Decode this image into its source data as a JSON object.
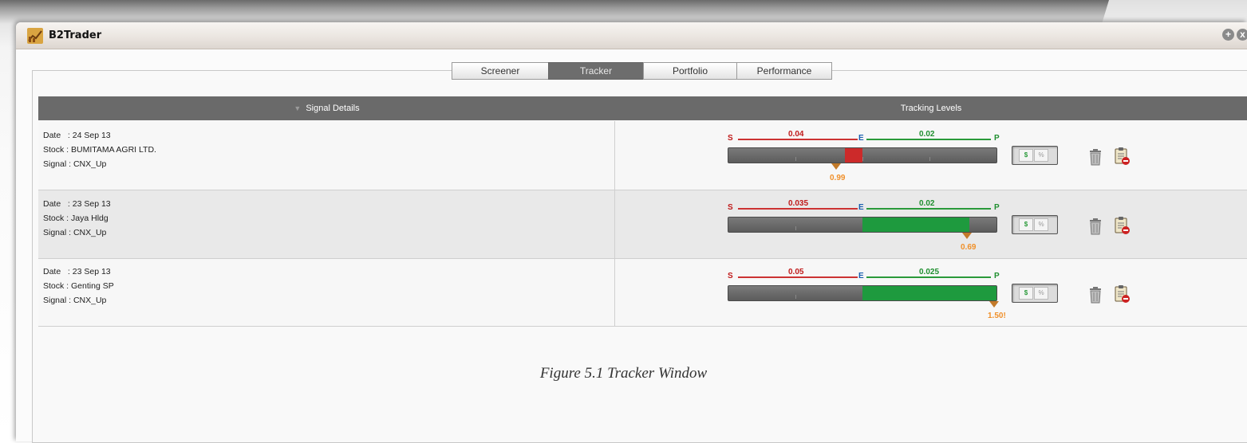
{
  "window": {
    "title": "B2Trader",
    "buttons": [
      "+",
      "x"
    ]
  },
  "tabs": [
    {
      "label": "Screener",
      "active": false
    },
    {
      "label": "Tracker",
      "active": true
    },
    {
      "label": "Portfolio",
      "active": false
    },
    {
      "label": "Performance",
      "active": false
    }
  ],
  "table": {
    "headers": {
      "signal": "Signal Details",
      "sort_indicator": "▼",
      "tracking": "Tracking Levels"
    },
    "level_labels": {
      "s": "S",
      "e": "E",
      "p": "P"
    },
    "toggle": {
      "dollar": "$",
      "percent": "%"
    },
    "rows": [
      {
        "date": "Date   : 24 Sep 13",
        "stock": "Stock : BUMITAMA AGRI LTD.",
        "signal": "Signal : CNX_Up",
        "stop_diff": "0.04",
        "profit_diff": "0.02",
        "current": "0.99",
        "fill_fraction": 0.1,
        "fill_color": "red"
      },
      {
        "date": "Date   : 23 Sep 13",
        "stock": "Stock : Jaya Hldg",
        "signal": "Signal : CNX_Up",
        "stop_diff": "0.035",
        "profit_diff": "0.02",
        "current": "0.69",
        "fill_fraction": 0.8,
        "fill_color": "green"
      },
      {
        "date": "Date   : 23 Sep 13",
        "stock": "Stock : Genting SP",
        "signal": "Signal : CNX_Up",
        "stop_diff": "0.05",
        "profit_diff": "0.025",
        "current": "1.50!",
        "fill_fraction": 1.0,
        "fill_color": "green"
      }
    ]
  },
  "caption": "Figure 5.1 Tracker Window",
  "colors": {
    "header_bg": "#6a6a6a",
    "stop": "#c01a1a",
    "entry": "#1a5fb0",
    "profit": "#1f8f2f",
    "marker": "#f0902a"
  }
}
